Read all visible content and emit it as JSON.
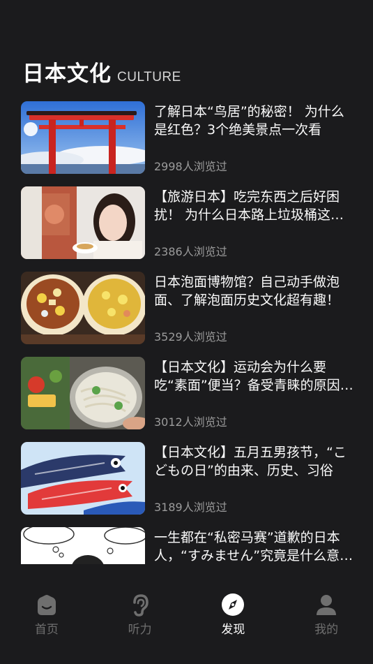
{
  "header": {
    "title": "日本文化",
    "subtitle": "CULTURE"
  },
  "articles": [
    {
      "title": "了解日本“鸟居”的秘密！ 为什么是红色？3个绝美景点一次看",
      "views": "2998人浏览过",
      "thumb": "torii-gate-photo"
    },
    {
      "title": "【旅游日本】吃完东西之后好困扰！ 为什么日本路上垃圾桶这么少？",
      "views": "2386人浏览过",
      "thumb": "girl-eating-photo"
    },
    {
      "title": "日本泡面博物馆？自己动手做泡面、了解泡面历史文化超有趣！",
      "views": "3529人浏览过",
      "thumb": "cup-noodles-photo"
    },
    {
      "title": "【日本文化】运动会为什么要吃“素面”便当？备受青睐的原因是？",
      "views": "3012人浏览过",
      "thumb": "somen-bento-photo"
    },
    {
      "title": "【日本文化】五月五男孩节，“こどもの日”的由来、历史、习俗",
      "views": "3189人浏览过",
      "thumb": "koinobori-photo"
    },
    {
      "title": "一生都在“私密马赛”道歉的日本人，“すみません”究竟是什么意思？",
      "views": "",
      "thumb": "sumimasen-cartoon"
    }
  ],
  "tabbar": [
    {
      "label": "首页",
      "icon": "home-icon",
      "active": false
    },
    {
      "label": "听力",
      "icon": "ear-icon",
      "active": false
    },
    {
      "label": "发现",
      "icon": "compass-icon",
      "active": true
    },
    {
      "label": "我的",
      "icon": "user-icon",
      "active": false
    }
  ]
}
